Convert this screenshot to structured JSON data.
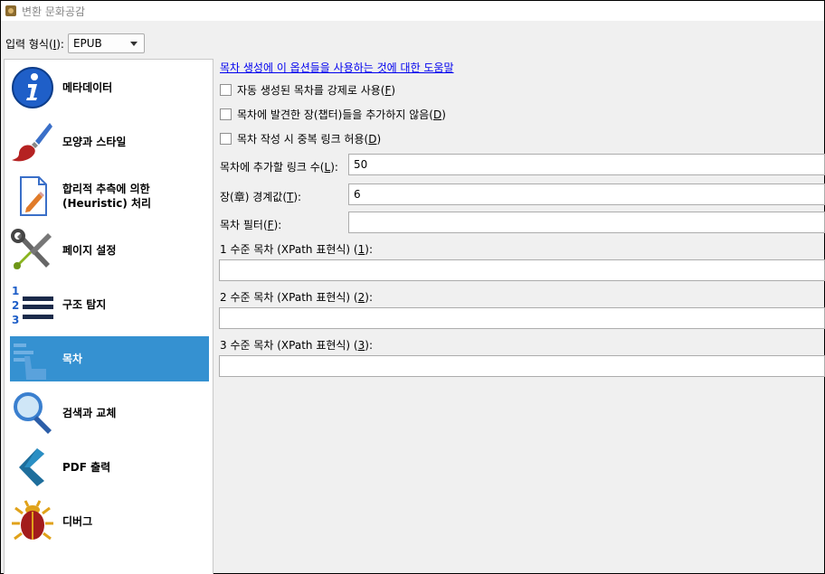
{
  "window": {
    "title": "변환 문화공감"
  },
  "input_format": {
    "label": "입력 형식(",
    "mnemonic": "I",
    "label_end": "):",
    "value": "EPUB"
  },
  "sidebar": {
    "items": [
      {
        "label": "메타데이터",
        "icon": "info-icon"
      },
      {
        "label": "모양과 스타일",
        "icon": "paintbrush-icon"
      },
      {
        "label": "합리적 추측에 의한\n(Heuristic) 처리",
        "icon": "document-pencil-icon"
      },
      {
        "label": "페이지 설정",
        "icon": "wrench-screwdriver-icon"
      },
      {
        "label": "구조 탐지",
        "icon": "numbered-list-icon"
      },
      {
        "label": "목차",
        "icon": "toc-icon",
        "selected": true
      },
      {
        "label": "검색과 교체",
        "icon": "magnifier-icon"
      },
      {
        "label": "PDF 출력",
        "icon": "chevron-left-icon"
      },
      {
        "label": "디버그",
        "icon": "bug-icon"
      }
    ]
  },
  "toc": {
    "help_link": "목차 생성에 이 옵션들을 사용하는 것에 대한 도움말",
    "checkboxes": [
      {
        "label": "자동 생성된 목차를 강제로 사용(",
        "mnemonic": "F",
        "end": ")",
        "checked": false
      },
      {
        "label": "목차에 발견한 장(챕터)들을 추가하지 않음(",
        "mnemonic": "D",
        "end": ")",
        "checked": false
      },
      {
        "label": "목차 작성 시 중복 링크 허용(",
        "mnemonic": "D",
        "end": ")",
        "checked": false
      }
    ],
    "links_label": "목차에 추가할 링크 수(",
    "links_mn": "L",
    "links_end": "):",
    "links_value": "50",
    "chapter_label": "장(章) 경계값(",
    "chapter_mn": "T",
    "chapter_end": "):",
    "chapter_value": "6",
    "filter_label": "목차 필터(",
    "filter_mn": "F",
    "filter_end": "):",
    "filter_value": "",
    "level1_label": "1 수준 목차 (XPath 표현식) (",
    "level1_mn": "1",
    "level1_end": "):",
    "level2_label": "2 수준 목차 (XPath 표현식) (",
    "level2_mn": "2",
    "level2_end": "):",
    "level3_label": "3 수준 목차 (XPath 표현식) (",
    "level3_mn": "3",
    "level3_end": "):",
    "level1_value": "",
    "level2_value": "",
    "level3_value": ""
  },
  "colors": {
    "selected": "#3591d1",
    "link": "#0000ee"
  }
}
